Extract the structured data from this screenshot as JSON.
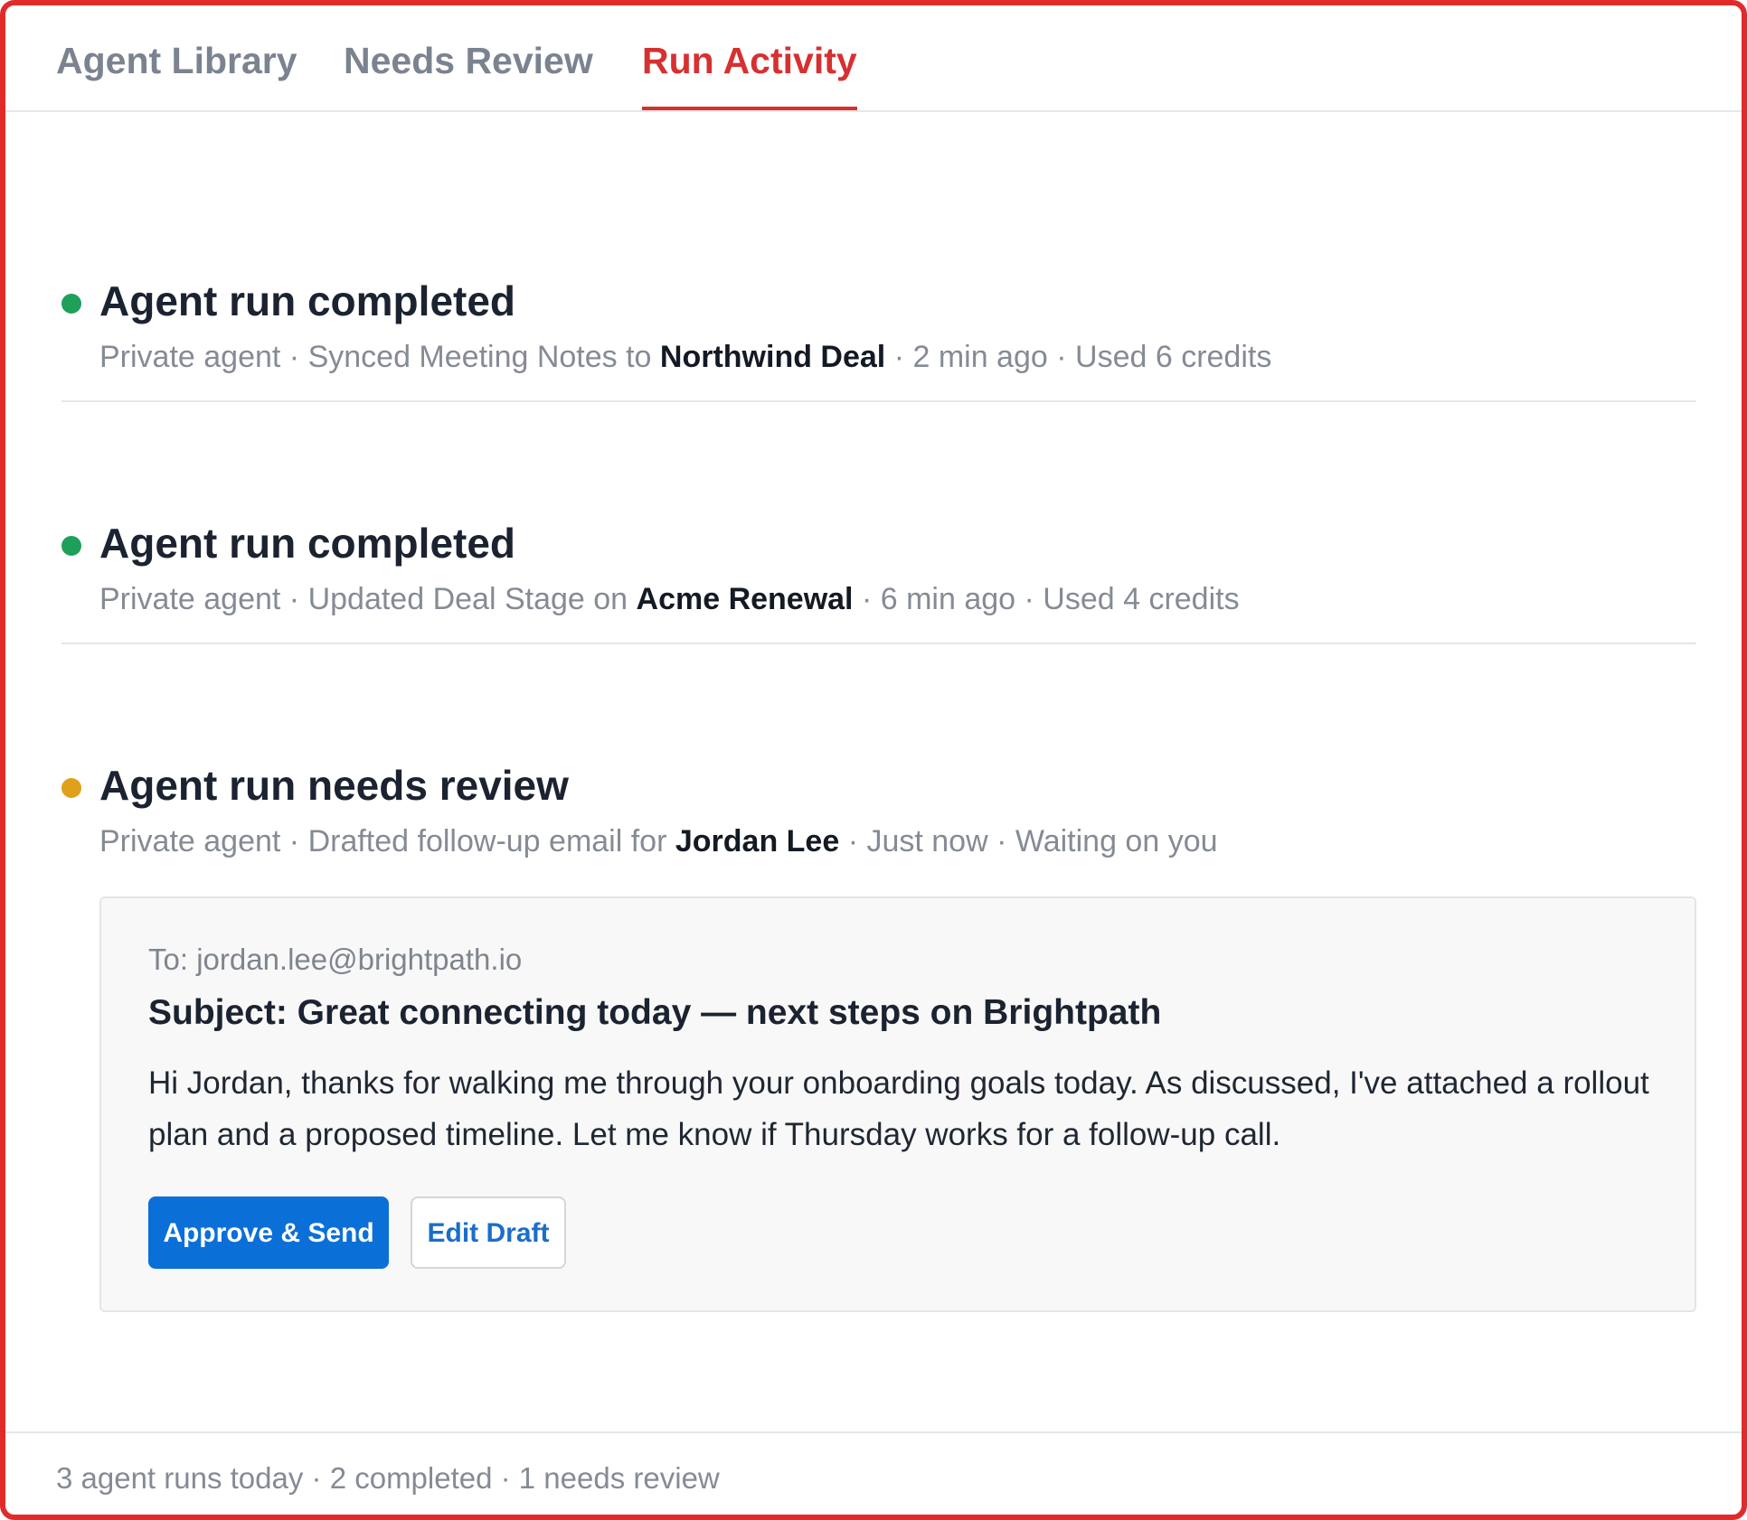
{
  "tabs": [
    {
      "label": "Agent Library",
      "active": false
    },
    {
      "label": "Needs Review",
      "active": false
    },
    {
      "label": "Run Activity",
      "active": true
    }
  ],
  "colors": {
    "accent": "#d63030",
    "completed": "#1fa05a",
    "needs_review": "#e1a019",
    "primary_button": "#0b6fd8"
  },
  "runs": [
    {
      "status": "completed",
      "status_icon": "status-dot-icon",
      "title": "Agent run completed",
      "scope": "Private agent",
      "sep1": " · ",
      "action": "Synced Meeting Notes to ",
      "target": "Northwind Deal",
      "sep2": " · ",
      "time": "2 min ago",
      "sep3": " · ",
      "detail": "Used 6 credits"
    },
    {
      "status": "completed",
      "status_icon": "status-dot-icon",
      "title": "Agent run completed",
      "scope": "Private agent",
      "sep1": " · ",
      "action": "Updated Deal Stage on ",
      "target": "Acme Renewal",
      "sep2": " · ",
      "time": "6 min ago",
      "sep3": " · ",
      "detail": "Used 4 credits"
    },
    {
      "status": "needs_review",
      "status_icon": "status-dot-icon",
      "title": "Agent run needs review",
      "scope": "Private agent",
      "sep1": " · ",
      "action": "Drafted follow-up email for ",
      "target": "Jordan Lee",
      "sep2": " · ",
      "time": "Just now",
      "sep3": " · ",
      "detail": "Waiting on you"
    }
  ],
  "draft": {
    "to": "To: jordan.lee@brightpath.io",
    "subject": "Subject: Great connecting today — next steps on Brightpath",
    "body": "Hi Jordan, thanks for walking me through your onboarding goals today. As discussed, I've attached a rollout plan and a proposed timeline. Let me know if Thursday works for a follow-up call.",
    "approve_label": "Approve & Send",
    "edit_label": "Edit Draft"
  },
  "footer": {
    "summary": "3 agent runs today · 2 completed · 1 needs review"
  }
}
